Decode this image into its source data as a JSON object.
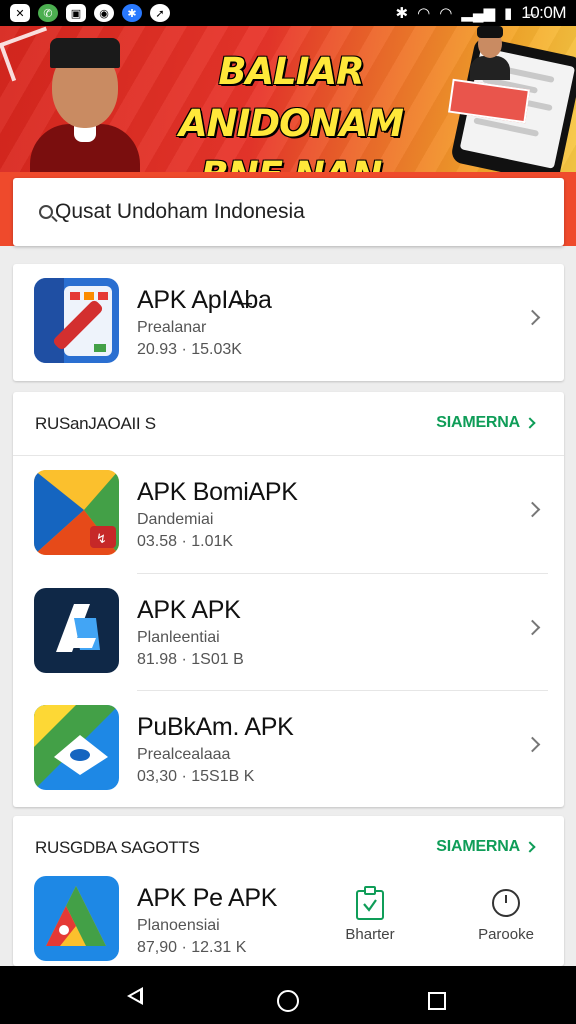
{
  "status_bar": {
    "icons": [
      "x-app-icon",
      "whatsapp-icon",
      "image-icon",
      "ok-icon",
      "settings-icon",
      "compass-icon"
    ],
    "right_icons": [
      "bluetooth-icon",
      "wifi-icon",
      "wifi-alt-icon",
      "signal-icon",
      "battery-icon"
    ],
    "time": "1̶0:0M"
  },
  "banner": {
    "line1": "BALIAR ANIDONAM",
    "line2": "BNE NAN NMANEIA!"
  },
  "search": {
    "text": "Qusat Undoham Indonesia"
  },
  "featured": {
    "name": "APK ApIA̶ba",
    "sub": "Prealanar",
    "meta": "20.93 · 15.03K"
  },
  "section1": {
    "title": "RUSanJAOAII S",
    "more": "SIAMERNA",
    "apps": [
      {
        "name": "APK BomiAPK",
        "sub": "Dandemiai",
        "meta": "03.58 · 1.01K"
      },
      {
        "name": "APK APK",
        "sub": "Planleentiai",
        "meta": "81.98 · 1S01 B"
      },
      {
        "name": "PuBkAm. APK",
        "sub": "Prealcealaaa",
        "meta": "03,30 · 15S1B K"
      }
    ]
  },
  "section2": {
    "title": "RUSGDBA SAGOTTS",
    "more": "SIAMERNA",
    "app": {
      "name": "APK Pe APK",
      "sub": "Planoensiai",
      "meta": "87,90 · 12.31 K"
    },
    "actions": [
      {
        "label": "Bharter",
        "icon": "clipboard-check-icon"
      },
      {
        "label": "Parooke",
        "icon": "clock-icon"
      }
    ]
  },
  "colors": {
    "accent_green": "#0f9d58",
    "banner_red": "#d7261e",
    "banner_yellow": "#ffe83a"
  }
}
